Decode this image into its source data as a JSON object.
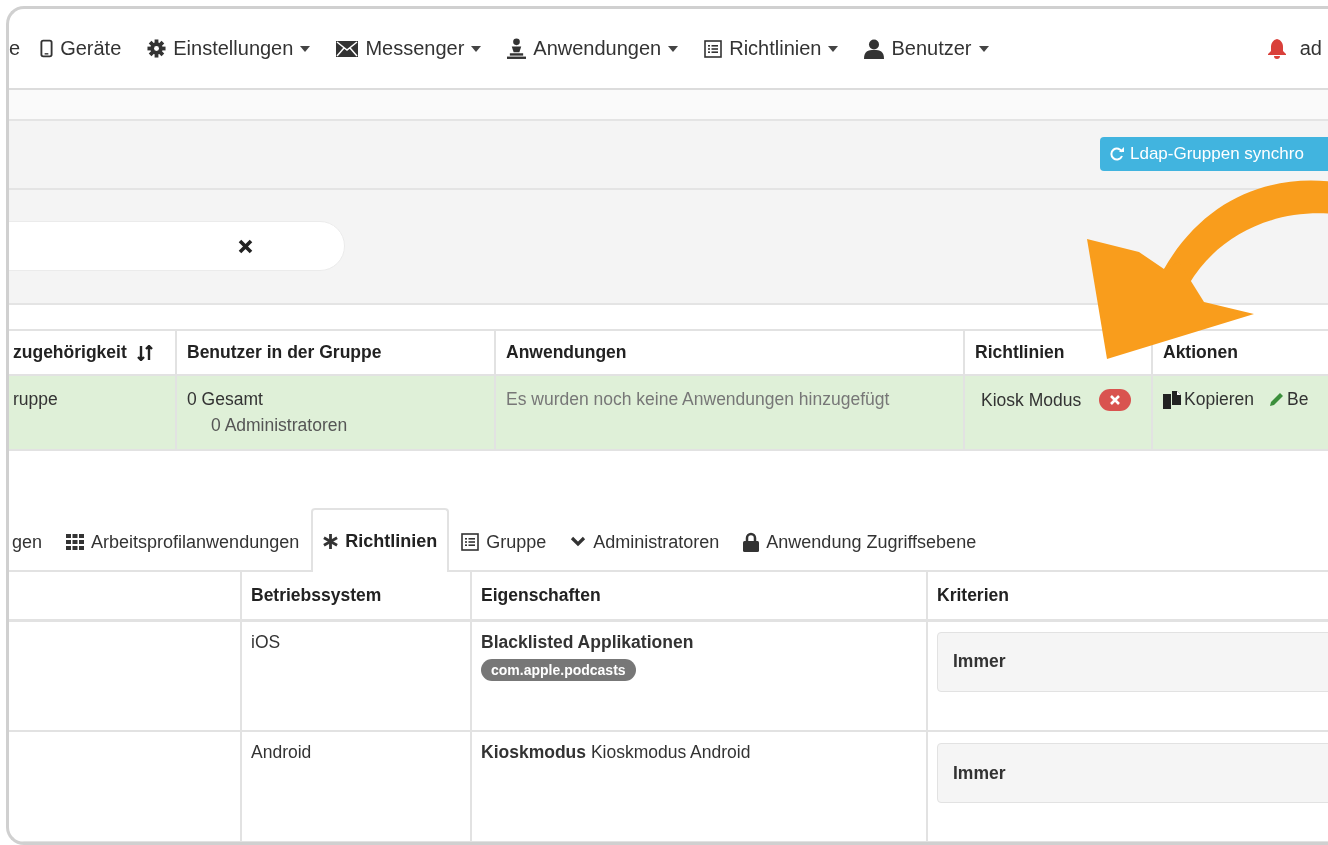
{
  "nav": {
    "items": [
      {
        "label": "e",
        "dropdown": false
      },
      {
        "label": "Geräte",
        "dropdown": false
      },
      {
        "label": "Einstellungen",
        "dropdown": true
      },
      {
        "label": "Messenger",
        "dropdown": true
      },
      {
        "label": "Anwendungen",
        "dropdown": true
      },
      {
        "label": "Richtlinien",
        "dropdown": true
      },
      {
        "label": "Benutzer",
        "dropdown": true
      }
    ],
    "user": "ad"
  },
  "toolbar": {
    "sync_button": "Ldap-Gruppen synchro"
  },
  "groups_table": {
    "columns": [
      "zugehörigkeit",
      "Benutzer in der Gruppe",
      "Anwendungen",
      "Richtlinien",
      "Aktionen"
    ],
    "rows": [
      {
        "highlighted": true,
        "membership": "ruppe",
        "users_total": "0 Gesamt",
        "users_admins": "0 Administratoren",
        "applications": "Es wurden noch keine Anwendungen hinzugefügt",
        "policies": [
          "Kiosk Modus"
        ],
        "actions": [
          "Kopieren",
          "Be"
        ]
      }
    ]
  },
  "tabs": [
    {
      "label": "gen",
      "selected": false
    },
    {
      "label": "Arbeitsprofilanwendungen",
      "selected": false
    },
    {
      "label": "Richtlinien",
      "selected": true
    },
    {
      "label": "Gruppe",
      "selected": false
    },
    {
      "label": "Administratoren",
      "selected": false
    },
    {
      "label": "Anwendung Zugriffsebene",
      "selected": false
    }
  ],
  "policies_table": {
    "columns": [
      "Betriebssystem",
      "Eigenschaften",
      "Kriterien"
    ],
    "rows": [
      {
        "os": "iOS",
        "property_name": "Blacklisted Applikationen",
        "tags": [
          "com.apple.podcasts"
        ],
        "criteria": "Immer"
      },
      {
        "os": "Android",
        "property_name": "Kioskmodus",
        "property_detail": "Kioskmodus Android",
        "criteria": "Immer"
      }
    ]
  }
}
